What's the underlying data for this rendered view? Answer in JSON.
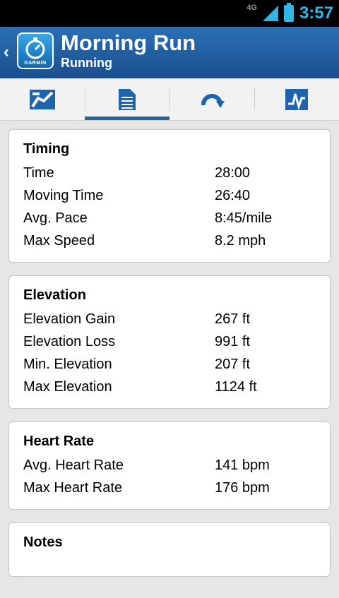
{
  "status": {
    "network": "4G",
    "time": "3:57"
  },
  "header": {
    "title": "Morning Run",
    "subtitle": "Running",
    "logo_text": "GARMIN"
  },
  "tabs": [
    {
      "icon": "map-route-icon"
    },
    {
      "icon": "document-details-icon",
      "active": true
    },
    {
      "icon": "loop-laps-icon"
    },
    {
      "icon": "graph-chart-icon"
    }
  ],
  "timing": {
    "title": "Timing",
    "rows": [
      {
        "label": "Time",
        "value": "28:00"
      },
      {
        "label": "Moving Time",
        "value": "26:40"
      },
      {
        "label": "Avg. Pace",
        "value": "8:45/mile"
      },
      {
        "label": "Max Speed",
        "value": "8.2 mph"
      }
    ]
  },
  "elevation": {
    "title": "Elevation",
    "rows": [
      {
        "label": "Elevation Gain",
        "value": "267 ft"
      },
      {
        "label": "Elevation Loss",
        "value": "991 ft"
      },
      {
        "label": "Min. Elevation",
        "value": "207 ft"
      },
      {
        "label": "Max Elevation",
        "value": "1124 ft"
      }
    ]
  },
  "heart_rate": {
    "title": "Heart Rate",
    "rows": [
      {
        "label": "Avg. Heart Rate",
        "value": "141 bpm"
      },
      {
        "label": "Max Heart Rate",
        "value": "176 bpm"
      }
    ]
  },
  "notes": {
    "title": "Notes"
  },
  "colors": {
    "header_blue": "#2b6fb5",
    "accent_blue": "#1c64ad",
    "status_blue": "#31b6e7"
  }
}
